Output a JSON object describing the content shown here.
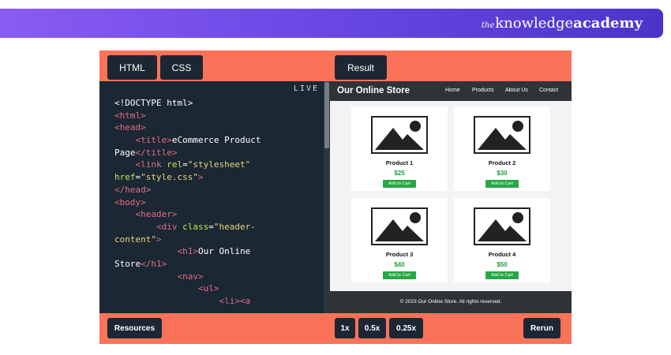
{
  "brand": {
    "prefix": "the",
    "name": "knowledge",
    "suffix": "academy"
  },
  "tabs": {
    "html": "HTML",
    "css": "CSS",
    "result": "Result"
  },
  "editor": {
    "live_label": "LIVE",
    "lines": [
      [
        [
          "txt",
          "<!DOCTYPE html>"
        ]
      ],
      [
        [
          "tag",
          "<html>"
        ]
      ],
      [
        [
          "tag",
          "<head>"
        ]
      ],
      [
        [
          "txt",
          "    "
        ],
        [
          "tag",
          "<title>"
        ],
        [
          "txt",
          "eCommerce Product"
        ]
      ],
      [
        [
          "txt",
          "Page"
        ],
        [
          "tag",
          "</title>"
        ]
      ],
      [
        [
          "txt",
          "    "
        ],
        [
          "tag",
          "<link "
        ],
        [
          "attr",
          "rel"
        ],
        [
          "txt",
          "="
        ],
        [
          "str",
          "\"stylesheet\""
        ]
      ],
      [
        [
          "attr",
          "href"
        ],
        [
          "txt",
          "="
        ],
        [
          "str",
          "\"style.css\""
        ],
        [
          "tag",
          ">"
        ]
      ],
      [
        [
          "tag",
          "</head>"
        ]
      ],
      [
        [
          "tag",
          "<body>"
        ]
      ],
      [
        [
          "txt",
          "    "
        ],
        [
          "tag",
          "<header>"
        ]
      ],
      [
        [
          "txt",
          "        "
        ],
        [
          "tag",
          "<div "
        ],
        [
          "attr",
          "class"
        ],
        [
          "txt",
          "="
        ],
        [
          "str",
          "\"header-"
        ]
      ],
      [
        [
          "str",
          "content\""
        ],
        [
          "tag",
          ">"
        ]
      ],
      [
        [
          "txt",
          "            "
        ],
        [
          "tag",
          "<h1>"
        ],
        [
          "txt",
          "Our Online"
        ]
      ],
      [
        [
          "txt",
          "Store"
        ],
        [
          "tag",
          "</h1>"
        ]
      ],
      [
        [
          "txt",
          "            "
        ],
        [
          "tag",
          "<nav>"
        ]
      ],
      [
        [
          "txt",
          "                "
        ],
        [
          "tag",
          "<ul>"
        ]
      ],
      [
        [
          "txt",
          "                    "
        ],
        [
          "tag",
          "<li><a"
        ]
      ]
    ]
  },
  "preview": {
    "site_title": "Our Online Store",
    "nav": [
      "Home",
      "Products",
      "About Us",
      "Contact"
    ],
    "products": [
      {
        "name": "Product 1",
        "price": "$25",
        "button": "Add to Cart"
      },
      {
        "name": "Product 2",
        "price": "$30",
        "button": "Add to Cart"
      },
      {
        "name": "Product 3",
        "price": "$40",
        "button": "Add to Cart"
      },
      {
        "name": "Product 4",
        "price": "$50",
        "button": "Add to Cart"
      }
    ],
    "footer": "© 2023 Our Online Store. All rights reserved."
  },
  "toolbar": {
    "resources": "Resources",
    "zoom": [
      "1x",
      "0.5x",
      "0.25x"
    ],
    "rerun": "Rerun"
  },
  "colors": {
    "banner_start": "#8a5cf2",
    "banner_end": "#4b34c9",
    "frame": "#fa7358",
    "editor_bg": "#1b2733",
    "button_bg": "#1c2733",
    "price_green": "#1f9d3a",
    "cart_green": "#27a844"
  }
}
